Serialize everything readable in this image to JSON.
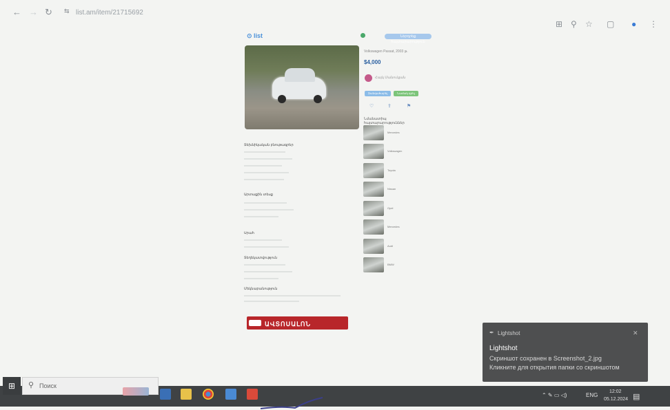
{
  "browser": {
    "url": "list.am/item/21715692",
    "back_icon": "arrow-left-icon",
    "forward_icon": "arrow-right-icon",
    "reload_icon": "reload-icon"
  },
  "page": {
    "site_logo": "⊙ list",
    "header_button": "Ներդրեք հայտարարություն",
    "listing_title": "Volkswagen Passat, 2003 թ.",
    "price": "$4,000",
    "seller_name": "Հայկ Մանուկյան",
    "contact_call": "Զանգահարել",
    "contact_msg": "Նամակ գրել",
    "related_heading": "Նմանատիպ հայտարարություններ",
    "related_items": [
      "Mercedes",
      "Volkswagen",
      "Toyota",
      "Nissan",
      "Opel",
      "Mercedes",
      "Audi",
      "BMW"
    ],
    "sections": [
      "Տեխնիկական բնութագրեր",
      "Արտաքին տեսք",
      "Սրահ",
      "Տեղեկատվություն",
      "Մեկնաբանություն"
    ],
    "banner_text": "ԱՎՏՈՍԱԼՈՆ"
  },
  "toast": {
    "app": "Lightshot",
    "title": "Lightshot",
    "line1": "Скриншот сохранен в Screenshot_2.jpg",
    "line2": "Кликните для открытия папки со скриншотом",
    "close_icon": "close-icon"
  },
  "taskbar": {
    "search_placeholder": "Поиск",
    "language": "ENG",
    "time": "12:02",
    "date": "05.12.2024"
  },
  "colors": {
    "taskbar": "#3f4244",
    "toast": "#4e4f50",
    "price_accent": "#2a5fa0",
    "banner": "#b8262a"
  }
}
